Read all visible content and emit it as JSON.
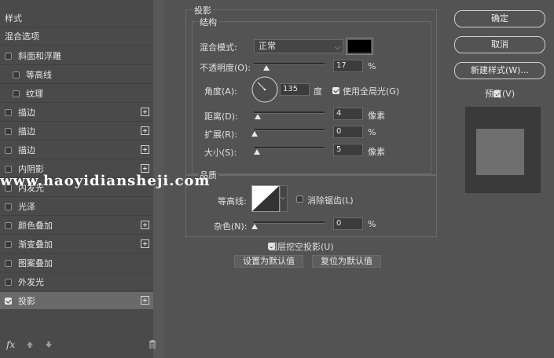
{
  "left_list": {
    "header": "样式",
    "blend_options": "混合选项",
    "items": [
      {
        "label": "斜面和浮雕",
        "checked": false,
        "plus": false
      },
      {
        "label": "等高线",
        "checked": false,
        "plus": false
      },
      {
        "label": "纹理",
        "checked": false,
        "plus": false
      },
      {
        "label": "描边",
        "checked": false,
        "plus": true
      },
      {
        "label": "描边",
        "checked": false,
        "plus": true
      },
      {
        "label": "描边",
        "checked": false,
        "plus": true
      },
      {
        "label": "内阴影",
        "checked": false,
        "plus": true
      },
      {
        "label": "内发光",
        "checked": false,
        "plus": false
      },
      {
        "label": "光泽",
        "checked": false,
        "plus": false
      },
      {
        "label": "颜色叠加",
        "checked": false,
        "plus": true
      },
      {
        "label": "渐变叠加",
        "checked": false,
        "plus": true
      },
      {
        "label": "图案叠加",
        "checked": false,
        "plus": false
      },
      {
        "label": "外发光",
        "checked": false,
        "plus": false
      },
      {
        "label": "投影",
        "checked": true,
        "plus": true
      }
    ],
    "fx_label": "fx"
  },
  "main": {
    "title": "投影",
    "structure_title": "结构",
    "blend_mode_label": "混合模式:",
    "blend_mode_value": "正常",
    "shadow_color": "#000000",
    "opacity_label": "不透明度(O):",
    "opacity_value": "17",
    "opacity_unit": "%",
    "angle_label": "角度(A):",
    "angle_value": "135",
    "angle_unit": "度",
    "global_light_label": "使用全局光(G)",
    "global_light_checked": true,
    "distance_label": "距离(D):",
    "distance_value": "4",
    "distance_unit": "像素",
    "spread_label": "扩展(R):",
    "spread_value": "0",
    "spread_unit": "%",
    "size_label": "大小(S):",
    "size_value": "5",
    "size_unit": "像素",
    "quality_title": "品质",
    "contour_label": "等高线:",
    "antialias_label": "消除锯齿(L)",
    "antialias_checked": false,
    "noise_label": "杂色(N):",
    "noise_value": "0",
    "noise_unit": "%",
    "knockout_label": "图层挖空投影(U)",
    "knockout_checked": true,
    "set_default_label": "设置为默认值",
    "reset_default_label": "复位为默认值"
  },
  "right": {
    "ok_label": "确定",
    "cancel_label": "取消",
    "new_style_label": "新建样式(W)...",
    "preview_label": "预览(V)",
    "preview_checked": true
  },
  "watermark": "www.haoyidiansheji.com"
}
